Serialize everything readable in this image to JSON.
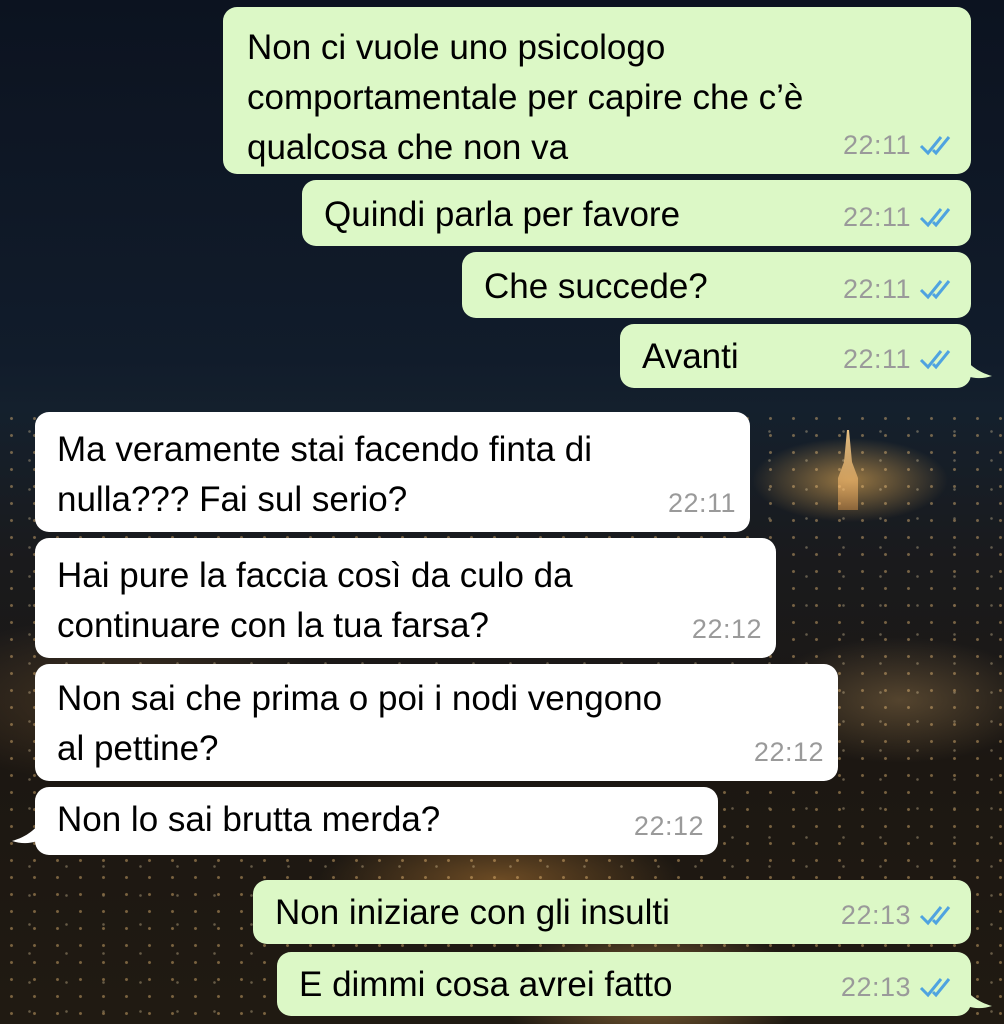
{
  "messages": [
    {
      "direction": "outgoing",
      "text": "Non ci vuole uno psicologo\ncomportamentale per capire che c’è\nqualcosa che non va",
      "time": "22:11",
      "status": "read-double-tick"
    },
    {
      "direction": "outgoing",
      "text": "Quindi parla per favore",
      "time": "22:11",
      "status": "read-double-tick"
    },
    {
      "direction": "outgoing",
      "text": "Che succede?",
      "time": "22:11",
      "status": "read-double-tick"
    },
    {
      "direction": "outgoing",
      "text": "Avanti",
      "time": "22:11",
      "status": "read-double-tick"
    },
    {
      "direction": "incoming",
      "text": "Ma veramente stai facendo finta di\nnulla??? Fai sul serio?",
      "time": "22:11"
    },
    {
      "direction": "incoming",
      "text": "Hai pure la faccia così da culo da\ncontinuare con la tua farsa?",
      "time": "22:12"
    },
    {
      "direction": "incoming",
      "text": "Non sai che prima o poi i nodi vengono\nal pettine?",
      "time": "22:12"
    },
    {
      "direction": "incoming",
      "text": "Non lo sai brutta merda?",
      "time": "22:12"
    },
    {
      "direction": "outgoing",
      "text": "Non iniziare con gli insulti",
      "time": "22:13",
      "status": "read-double-tick"
    },
    {
      "direction": "outgoing",
      "text": "E dimmi cosa avrei fatto",
      "time": "22:13",
      "status": "read-double-tick"
    }
  ],
  "colors": {
    "outgoing_bubble": "#dcf8c6",
    "incoming_bubble": "#ffffff",
    "read_ticks": "#4fa3e0",
    "timestamp": "#9a9a9a"
  }
}
